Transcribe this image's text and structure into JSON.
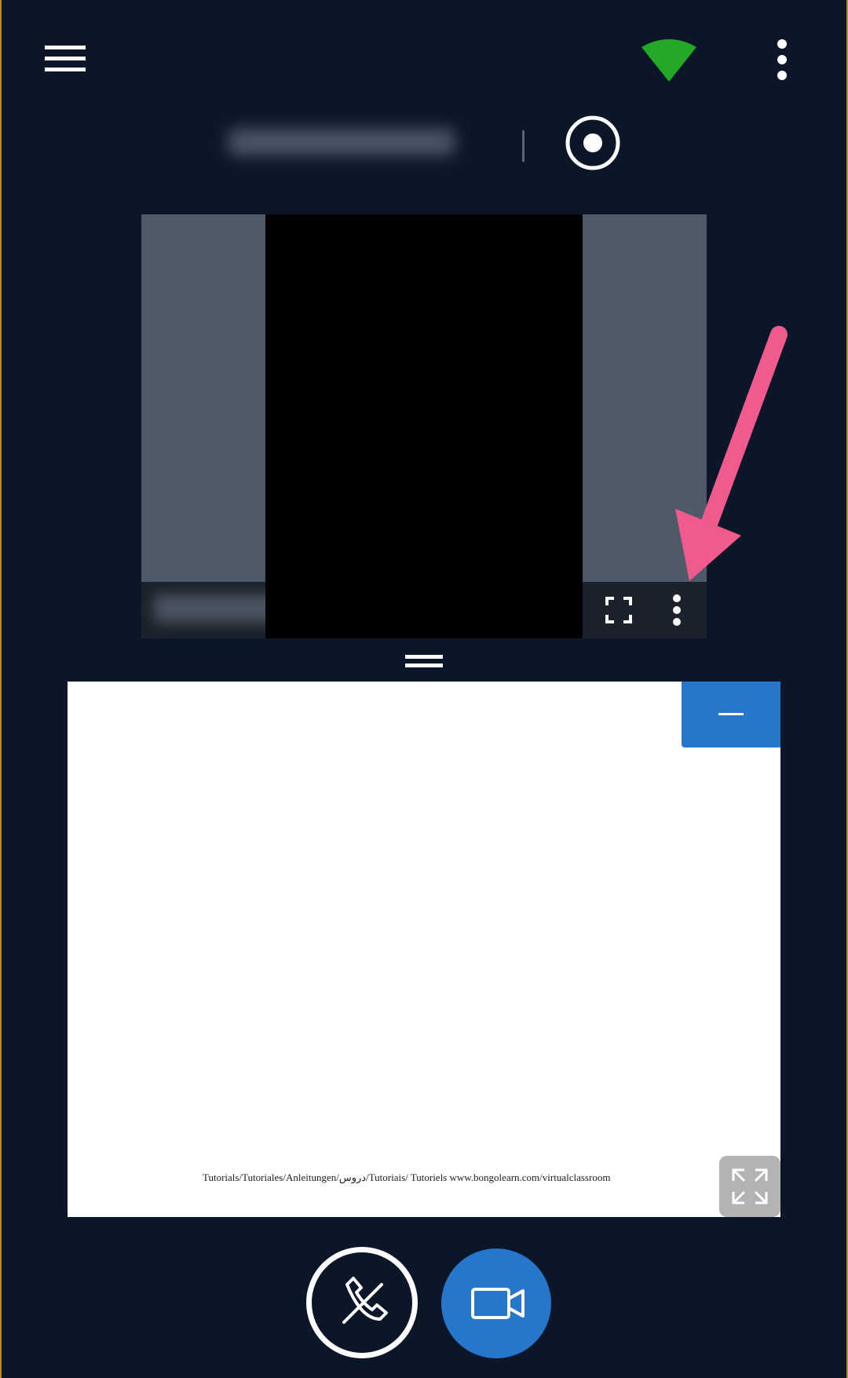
{
  "header": {
    "menu_icon": "hamburger-icon",
    "signal_icon": "wifi-signal-icon",
    "signal_color": "#23a828",
    "more_icon": "kebab-icon",
    "session_title": "",
    "record_icon": "record-icon"
  },
  "video": {
    "participant_name": "",
    "fullscreen_icon": "fullscreen-icon",
    "options_icon": "kebab-icon",
    "annotation_color": "#f05a8c"
  },
  "panel": {
    "drag_handle_icon": "drag-handle-icon",
    "minimize_icon": "minus-icon",
    "expand_icon": "expand-icon",
    "footer_text": "Tutorials/Tutoriales/Anleitungen/دروس/Tutoriais/ Tutoriels www.bongolearn.com/virtualclassroom"
  },
  "controls": {
    "hangup_icon": "phone-hangup-icon",
    "camera_icon": "video-camera-icon",
    "accent": "#2677cc"
  }
}
